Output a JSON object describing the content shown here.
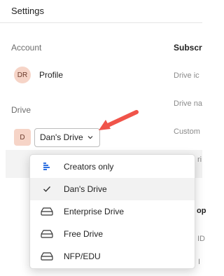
{
  "window": {
    "title": "Settings"
  },
  "sections": {
    "account": "Account",
    "drive": "Drive"
  },
  "account_items": [
    {
      "avatar": "DR",
      "label": "Profile"
    }
  ],
  "drive_selector": {
    "avatar": "D",
    "value": "Dan's Drive"
  },
  "right_column": {
    "heading": "Subscr",
    "labels": [
      "Drive ic",
      "Drive na",
      "Custom",
      "ri"
    ],
    "fragments": [
      "op",
      "ID",
      "I"
    ]
  },
  "dropdown": {
    "options": [
      {
        "label": "Creators only",
        "icon": "creators-icon",
        "selected": false
      },
      {
        "label": "Dan's Drive",
        "icon": "check-icon",
        "selected": true
      },
      {
        "label": "Enterprise Drive",
        "icon": "drive-icon",
        "selected": false
      },
      {
        "label": "Free Drive",
        "icon": "drive-icon",
        "selected": false
      },
      {
        "label": "NFP/EDU",
        "icon": "drive-icon",
        "selected": false
      }
    ]
  },
  "colors": {
    "accent_arrow": "#f0544a",
    "creators_icon": "#2d6fe0",
    "avatar_bg": "#f6d4c7"
  }
}
